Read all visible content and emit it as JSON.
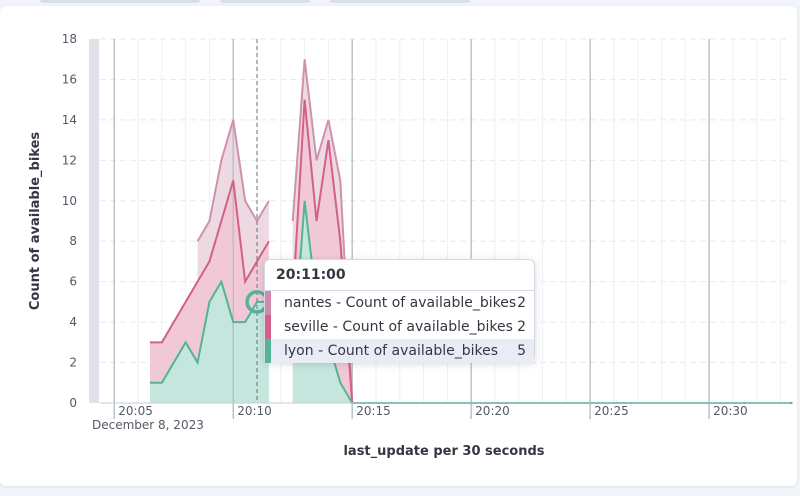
{
  "chart_data": {
    "type": "area",
    "stacked": true,
    "ylabel": "Count of available_bikes",
    "xlabel": "last_update per 30 seconds",
    "date_label": "December 8, 2023",
    "ylim": [
      0,
      18
    ],
    "yticks": [
      0,
      2,
      4,
      6,
      8,
      10,
      12,
      14,
      16,
      18
    ],
    "xticks": [
      "20:05",
      "20:10",
      "20:15",
      "20:20",
      "20:25",
      "20:30"
    ],
    "x_unit": "minutes past 20:00",
    "xlim": [
      4.4,
      33.4
    ],
    "grid": true,
    "colors": {
      "nantes": "#d36086",
      "seville": "#d36086",
      "lyon": "#54b399"
    },
    "series": [
      {
        "name": "lyon - Count of available_bikes",
        "color": "#54b399",
        "points": [
          [
            6.5,
            1
          ],
          [
            7.0,
            1
          ],
          [
            7.5,
            2
          ],
          [
            8.0,
            3
          ],
          [
            8.5,
            2
          ],
          [
            9.0,
            5
          ],
          [
            9.5,
            6
          ],
          [
            10.0,
            4
          ],
          [
            10.5,
            4
          ],
          [
            11.0,
            5
          ],
          [
            11.5,
            5
          ],
          [
            12.5,
            2
          ],
          [
            13.0,
            10
          ],
          [
            13.5,
            5
          ],
          [
            14.0,
            3
          ],
          [
            14.5,
            1
          ],
          [
            15.0,
            0
          ],
          [
            33.5,
            0
          ]
        ]
      },
      {
        "name": "seville - Count of available_bikes",
        "color": "#d36086",
        "points": [
          [
            6.5,
            2
          ],
          [
            7.0,
            2
          ],
          [
            7.5,
            2
          ],
          [
            8.0,
            2
          ],
          [
            8.5,
            4
          ],
          [
            9.0,
            2
          ],
          [
            9.5,
            3
          ],
          [
            10.0,
            7
          ],
          [
            10.5,
            2
          ],
          [
            11.0,
            2
          ],
          [
            11.5,
            3
          ],
          [
            12.5,
            3
          ],
          [
            13.0,
            5
          ],
          [
            13.5,
            4
          ],
          [
            14.0,
            10
          ],
          [
            14.5,
            7
          ],
          [
            15.0,
            0
          ],
          [
            33.5,
            0
          ]
        ]
      },
      {
        "name": "nantes - Count of available_bikes",
        "color": "#d36086",
        "points": [
          [
            8.5,
            2
          ],
          [
            9.0,
            2
          ],
          [
            9.5,
            3
          ],
          [
            10.0,
            3
          ],
          [
            10.5,
            4
          ],
          [
            11.0,
            2
          ],
          [
            11.5,
            2
          ],
          [
            12.5,
            4
          ],
          [
            13.0,
            2
          ],
          [
            13.5,
            3
          ],
          [
            14.0,
            1
          ],
          [
            14.5,
            3
          ],
          [
            15.0,
            0
          ],
          [
            33.5,
            0
          ]
        ]
      }
    ],
    "crosshair_x": "20:11:00",
    "tooltip": {
      "title": "20:11:00",
      "rows": [
        {
          "label": "nantes - Count of available_bikes",
          "value": "2",
          "color": "#d08aab"
        },
        {
          "label": "seville - Count of available_bikes",
          "value": "2",
          "color": "#d36086"
        },
        {
          "label": "lyon - Count of available_bikes",
          "value": "5",
          "color": "#54b399",
          "highlighted": true
        }
      ]
    }
  }
}
